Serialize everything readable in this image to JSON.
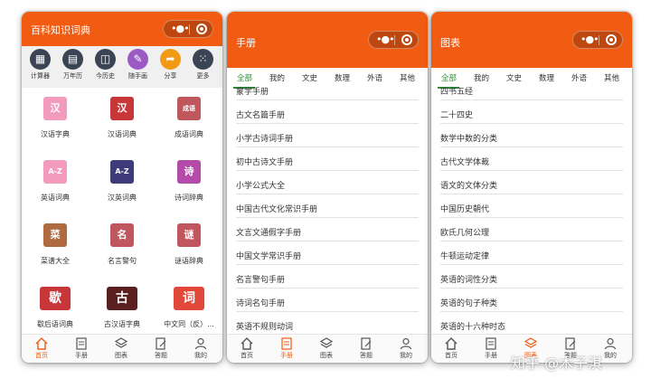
{
  "colors": {
    "header": "#f25b12",
    "tab_active": "#2e8b3a",
    "nav_active": "#f25b12"
  },
  "home": {
    "title": "百科知识词典",
    "tools": [
      {
        "label": "计算器",
        "icon": "calculator-icon"
      },
      {
        "label": "万年历",
        "icon": "calendar-icon"
      },
      {
        "label": "今历史",
        "icon": "book-history-icon"
      },
      {
        "label": "随手画",
        "icon": "pencil-icon"
      },
      {
        "label": "分享",
        "icon": "share-icon"
      },
      {
        "label": "更多",
        "icon": "more-grid-icon"
      }
    ],
    "grid": [
      {
        "label": "汉语字典",
        "glyph": "汉"
      },
      {
        "label": "汉语词典",
        "glyph": "汉"
      },
      {
        "label": "成语词典",
        "glyph": "成语"
      },
      {
        "label": "英语词典",
        "glyph": "A-Z"
      },
      {
        "label": "汉英词典",
        "glyph": "A-Z"
      },
      {
        "label": "诗词辞典",
        "glyph": "诗"
      },
      {
        "label": "菜谱大全",
        "glyph": "菜"
      },
      {
        "label": "名言警句",
        "glyph": "名"
      },
      {
        "label": "谜语辞典",
        "glyph": "谜"
      },
      {
        "label": "歇后语词典",
        "glyph": "歇"
      },
      {
        "label": "古汉语字典",
        "glyph": "古"
      },
      {
        "label": "中文同（反）...",
        "glyph": "词"
      }
    ]
  },
  "manual": {
    "title": "手册",
    "tabs": [
      "全部",
      "我的",
      "文史",
      "数理",
      "外语",
      "其他"
    ],
    "items": [
      "蒙学手册",
      "古文名篇手册",
      "小学古诗词手册",
      "初中古诗文手册",
      "小学公式大全",
      "中国古代文化常识手册",
      "文言文通假字手册",
      "中国文学常识手册",
      "名言警句手册",
      "诗词名句手册",
      "英语不规则动词"
    ]
  },
  "charts": {
    "title": "图表",
    "tabs": [
      "全部",
      "我的",
      "文史",
      "数理",
      "外语",
      "其他"
    ],
    "items": [
      "四书五经",
      "二十四史",
      "数学中数的分类",
      "古代文学体裁",
      "语文的文体分类",
      "中国历史朝代",
      "欧氏几何公理",
      "牛顿运动定律",
      "英语的词性分类",
      "英语的句子种类",
      "英语的十六种时态"
    ]
  },
  "nav": [
    "首页",
    "手册",
    "图表",
    "答题",
    "我的"
  ],
  "watermark": "知乎 @木子淇"
}
